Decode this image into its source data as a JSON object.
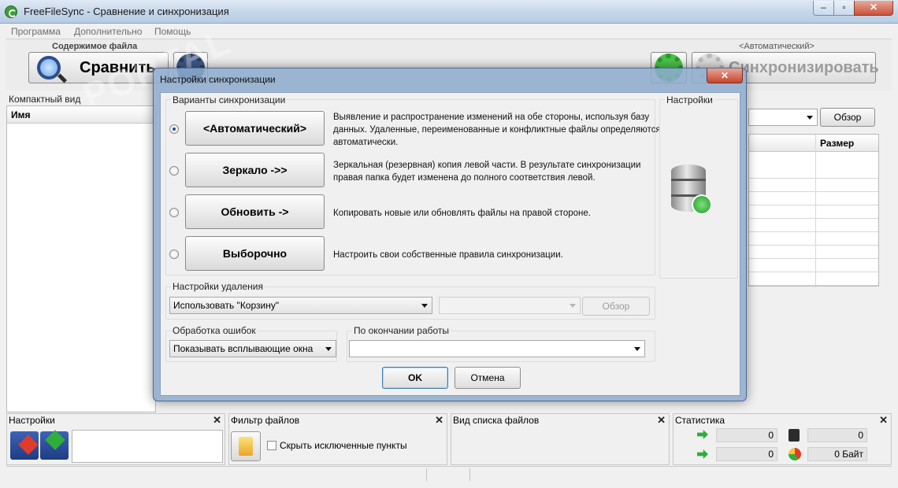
{
  "window": {
    "title": "FreeFileSync - Сравнение и синхронизация"
  },
  "menu": [
    "Программа",
    "Дополнительно",
    "Помощь"
  ],
  "toolbar": {
    "compare_group": "Содержимое файла",
    "compare_label": "Сравнить",
    "sync_group": "<Автоматический>",
    "sync_label": "Синхронизировать"
  },
  "left_panel": {
    "view_label": "Компактный вид",
    "col_name": "Имя"
  },
  "right_panel": {
    "browse": "Обзор",
    "col_size": "Размер"
  },
  "dialog": {
    "title": "Настройки синхронизации",
    "variants_title": "Варианты синхронизации",
    "settings_title": "Настройки",
    "variants": [
      {
        "label": "<Автоматический>",
        "desc": "Выявление и распространение изменений на обе стороны, используя базу данных. Удаленные, переименованные и конфликтные файлы определяются автоматически.",
        "selected": true
      },
      {
        "label": "Зеркало ->>",
        "desc": "Зеркальная (резервная) копия левой части. В результате синхронизации правая папка будет изменена до полного соответствия левой.",
        "selected": false
      },
      {
        "label": "Обновить ->",
        "desc": "Копировать новые или обновлять файлы на правой стороне.",
        "selected": false
      },
      {
        "label": "Выборочно",
        "desc": "Настроить свои собственные правила синхронизации.",
        "selected": false
      }
    ],
    "deletion_title": "Настройки удаления",
    "deletion_value": "Использовать \"Корзину\"",
    "deletion_browse": "Обзор",
    "errors_title": "Обработка ошибок",
    "errors_value": "Показывать всплывающие окна",
    "after_title": "По окончании работы",
    "after_value": "",
    "ok": "OK",
    "cancel": "Отмена"
  },
  "docks": {
    "settings": "Настройки",
    "filter": "Фильтр файлов",
    "filter_checkbox": "Скрыть исключенные пункты",
    "view": "Вид списка файлов",
    "stats": "Статистика",
    "stat_values": [
      "0",
      "0",
      "0",
      "0 Байт"
    ]
  },
  "watermark": "PORTAL",
  "colors": {
    "accent": "#3aa03a",
    "close_red": "#c4462f",
    "glass": "#8caacd"
  }
}
